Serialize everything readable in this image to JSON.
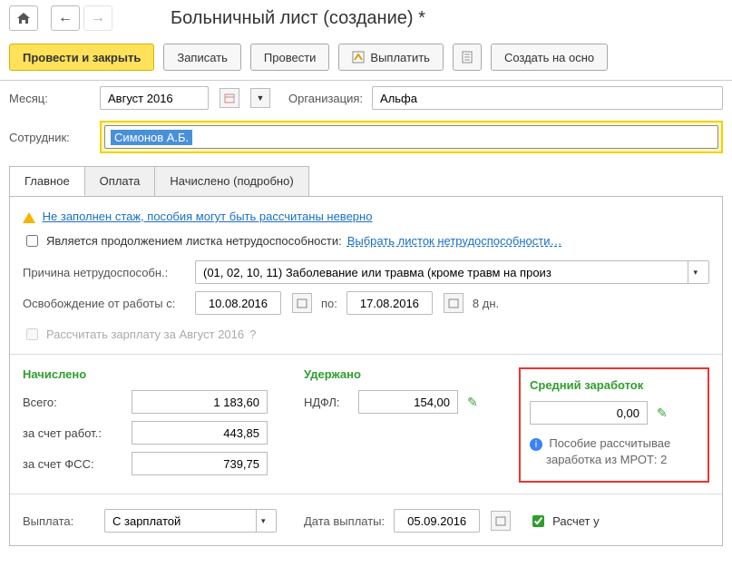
{
  "title": "Больничный лист (создание) *",
  "topButtons": {
    "home": "home-icon",
    "back": "←",
    "forward": "→"
  },
  "toolbar": {
    "post_close": "Провести и закрыть",
    "save": "Записать",
    "post": "Провести",
    "pay": "Выплатить",
    "create_based": "Создать на осно"
  },
  "fields": {
    "month_label": "Месяц:",
    "month_value": "Август 2016",
    "org_label": "Организация:",
    "org_value": "Альфа",
    "employee_label": "Сотрудник:",
    "employee_value": "Симонов А.Б."
  },
  "tabs": {
    "main": "Главное",
    "payment": "Оплата",
    "accrued": "Начислено (подробно)"
  },
  "main_tab": {
    "warning": "Не заполнен стаж, пособия могут быть рассчитаны неверно",
    "is_continuation": "Является продолжением листка нетрудоспособности:",
    "select_sheet": "Выбрать листок нетрудоспособности…",
    "reason_label": "Причина нетрудоспособн.:",
    "reason_value": "(01, 02, 10, 11) Заболевание или травма (кроме травм на произ",
    "absence_label": "Освобождение от работы с:",
    "date_from": "10.08.2016",
    "date_to_label": "по:",
    "date_to": "17.08.2016",
    "days": "8 дн.",
    "recalc_salary": "Рассчитать зарплату за Август 2016",
    "accrued_title": "Начислено",
    "withheld_title": "Удержано",
    "avg_title": "Средний заработок",
    "total_label": "Всего:",
    "total_value": "1 183,60",
    "employer_label": "за счет работ.:",
    "employer_value": "443,85",
    "fss_label": "за счет ФСС:",
    "fss_value": "739,75",
    "ndfl_label": "НДФЛ:",
    "ndfl_value": "154,00",
    "avg_value": "0,00",
    "mrot_info1": "Пособие рассчитывае",
    "mrot_info2": "заработка из МРОТ: 2",
    "payment_label": "Выплата:",
    "payment_value": "С зарплатой",
    "payment_date_label": "Дата выплаты:",
    "payment_date": "05.09.2016",
    "calc_check": "Расчет у"
  }
}
